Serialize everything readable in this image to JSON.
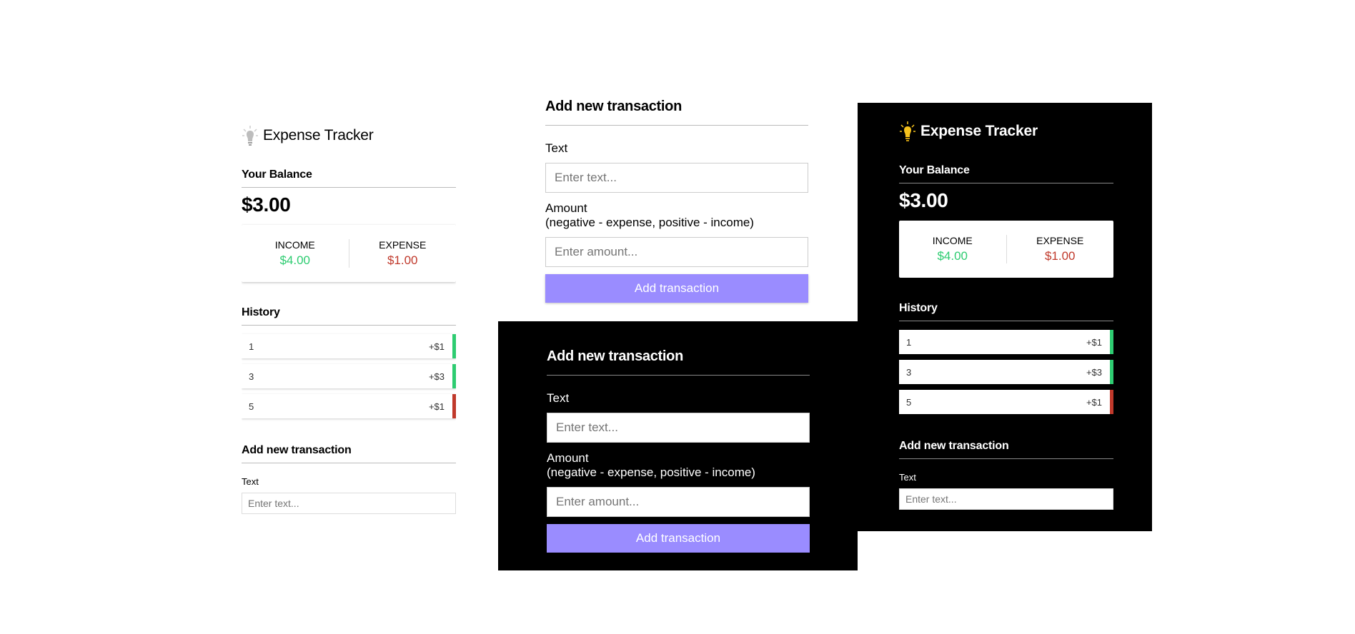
{
  "app": {
    "title": "Expense Tracker",
    "bulb_icon_light": "lightbulb-off-icon",
    "bulb_icon_dark": "lightbulb-on-icon"
  },
  "balance": {
    "label": "Your Balance",
    "amount": "$3.00"
  },
  "summary": {
    "income_label": "INCOME",
    "income_value": "$4.00",
    "expense_label": "EXPENSE",
    "expense_value": "$1.00"
  },
  "history": {
    "title": "History",
    "items": [
      {
        "text": "1",
        "amount": "+$1",
        "type": "plus"
      },
      {
        "text": "3",
        "amount": "+$3",
        "type": "plus"
      },
      {
        "text": "5",
        "amount": "+$1",
        "type": "minus"
      }
    ]
  },
  "form": {
    "title": "Add new transaction",
    "text_label": "Text",
    "text_placeholder": "Enter text...",
    "amount_label": "Amount",
    "amount_hint": "(negative - expense, positive - income)",
    "amount_placeholder": "Enter amount...",
    "submit_label": "Add transaction"
  },
  "colors": {
    "income": "#2ecc71",
    "expense": "#c0392b",
    "button": "#9a8cff",
    "dark_bg": "#000000",
    "bulb_on": "#f6c21c"
  }
}
